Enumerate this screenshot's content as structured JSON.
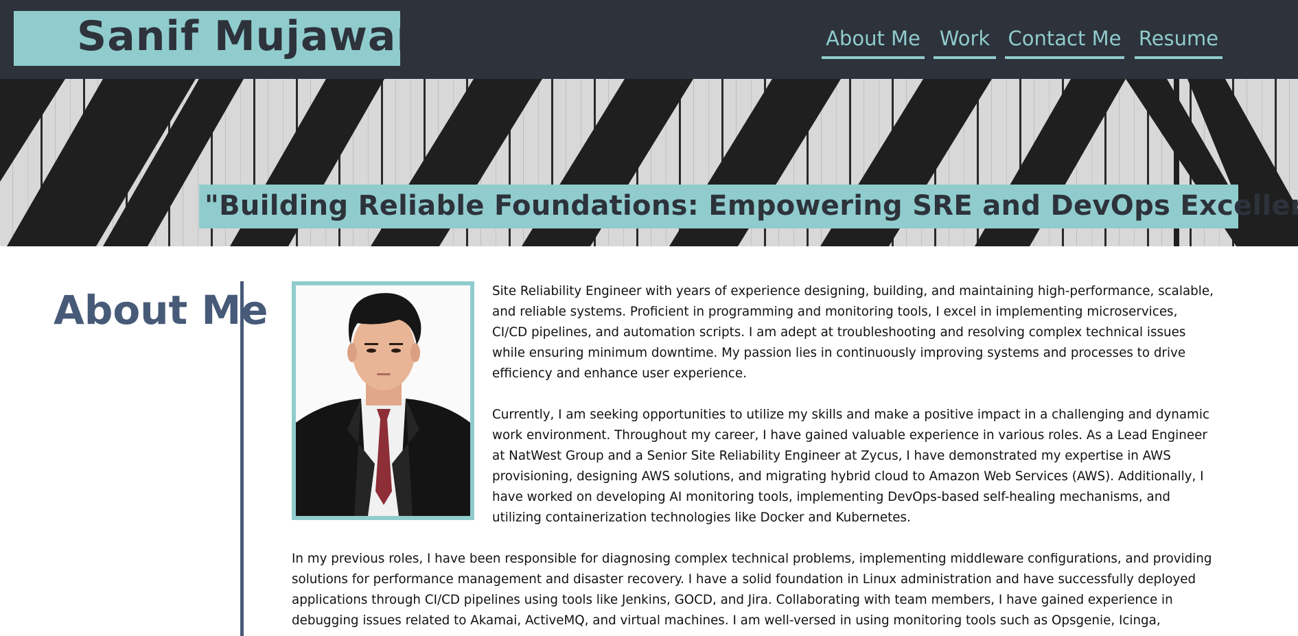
{
  "header": {
    "logo": "Sanif Mujawar",
    "nav": [
      {
        "label": "About Me"
      },
      {
        "label": "Work"
      },
      {
        "label": "Contact Me"
      },
      {
        "label": "Resume"
      }
    ]
  },
  "hero": {
    "tagline": "\"Building Reliable Foundations: Empowering SRE and DevOps Excellence\""
  },
  "about": {
    "heading": "About Me",
    "paragraphs": [
      "Site Reliability Engineer with years of experience designing, building, and maintaining high-performance, scalable, and reliable systems. Proficient in programming and monitoring tools, I excel in implementing microservices, CI/CD pipelines, and automation scripts. I am adept at troubleshooting and resolving complex technical issues while ensuring minimum downtime. My passion lies in continuously improving systems and processes to drive efficiency and enhance user experience.",
      "Currently, I am seeking opportunities to utilize my skills and make a positive impact in a challenging and dynamic work environment. Throughout my career, I have gained valuable experience in various roles. As a Lead Engineer at NatWest Group and a Senior Site Reliability Engineer at Zycus, I have demonstrated my expertise in AWS provisioning, designing AWS solutions, and migrating hybrid cloud to Amazon Web Services (AWS). Additionally, I have worked on developing AI monitoring tools, implementing DevOps-based self-healing mechanisms, and utilizing containerization technologies like Docker and Kubernetes.",
      "In my previous roles, I have been responsible for diagnosing complex technical problems, implementing middleware configurations, and providing solutions for performance management and disaster recovery. I have a solid foundation in Linux administration and have successfully deployed applications through CI/CD pipelines using tools like Jenkins, GOCD, and Jira. Collaborating with team members, I have gained experience in debugging issues related to Akamai, ActiveMQ, and virtual machines. I am well-versed in using monitoring tools such as Opsgenie, Icinga,"
    ]
  },
  "colors": {
    "header_bg": "#2d323b",
    "accent": "#90cccd",
    "heading": "#475a78"
  }
}
